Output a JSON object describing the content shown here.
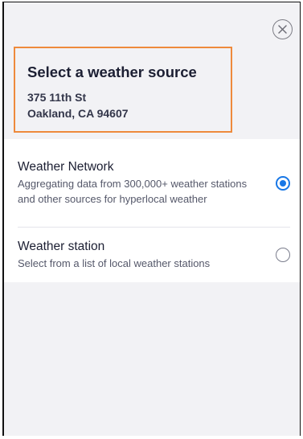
{
  "dialog": {
    "title": "Select a weather source",
    "address_line1": "375 11th St",
    "address_line2": "Oakland, CA 94607",
    "close_icon": "close-icon"
  },
  "options": [
    {
      "title": "Weather Network",
      "description": "Aggregating data from 300,000+ weather stations and other sources for hyperlocal weather",
      "selected": true
    },
    {
      "title": "Weather station",
      "description": "Select from a list of local weather stations",
      "selected": false
    }
  ],
  "colors": {
    "accent": "#1877e6",
    "highlight_border": "#ee8a3c",
    "panel_background": "#f2f2f5"
  }
}
